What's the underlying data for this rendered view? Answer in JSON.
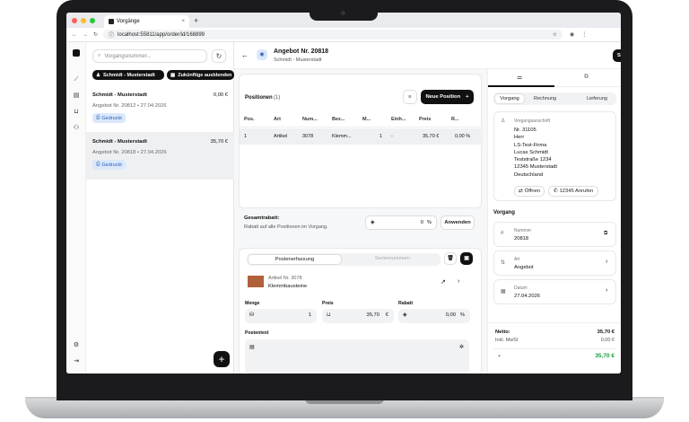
{
  "browser": {
    "tab_title": "Vorgänge",
    "url": "localhost:55811/app/order/id/168899"
  },
  "list": {
    "search_placeholder": "Vorgangsnummer...",
    "filter_customer": "Schmidt - Musterstadt",
    "filter_future": "Zukünftige ausblenden",
    "cards": [
      {
        "name": "Schmidt - Musterstadt",
        "amount": "0,00 €",
        "sub": "Angebot Nr. 20812 • 27.04.2026",
        "badge": "Gedruckt"
      },
      {
        "name": "Schmidt - Musterstadt",
        "amount": "35,70 €",
        "sub": "Angebot Nr. 20818 • 27.04.2026",
        "badge": "Gedruckt"
      }
    ]
  },
  "header": {
    "title": "Angebot Nr. 20818",
    "subtitle": "Schmidt - Musterstadt",
    "save": "Speichern"
  },
  "positions": {
    "title": "Positionen",
    "count": "(1)",
    "new_button": "Neue Position",
    "columns": [
      "Pos.",
      "Art",
      "Num...",
      "Bez...",
      "M...",
      "Einh...",
      "Preis",
      "R..."
    ],
    "rows": [
      [
        "1",
        "Artikel",
        "3078",
        "Klemm...",
        "1",
        "-",
        "35,70 €",
        "0,00 %"
      ]
    ]
  },
  "discount": {
    "title": "Gesamtrabatt:",
    "desc": "Rabatt auf alle Positionen im Vorgang.",
    "value": "0",
    "unit": "%",
    "apply": "Anwenden"
  },
  "editor": {
    "tab_active": "Postenerfassung",
    "tab_inactive": "Seriennummern",
    "article_no": "Artikel Nr. 3078",
    "article_name": "Klemmbausteine",
    "qty_label": "Menge",
    "qty": "1",
    "price_label": "Preis",
    "price": "35,70",
    "price_unit": "€",
    "discount_label": "Rabatt",
    "discount": "0,00",
    "discount_unit": "%",
    "text_label": "Postentext"
  },
  "side": {
    "tabs": [
      "Vorgang",
      "Rechnung",
      "Lieferung"
    ],
    "addr_label": "Vorgangsanschrift",
    "addr_lines": [
      "Nr. 31105",
      "Herr",
      "LS-Test-Firma",
      "Lucas Schmidt",
      "Teststraße 1234",
      "12345 Musterstadt",
      "Deutschland"
    ],
    "open": "Öffnen",
    "call": "12345 Anrufen",
    "section": "Vorgang",
    "fields": [
      {
        "label": "Nummer",
        "value": "20818"
      },
      {
        "label": "Art",
        "value": "Angebot"
      },
      {
        "label": "Datum",
        "value": "27.04.2026"
      }
    ],
    "net_label": "Netto:",
    "net": "35,70 €",
    "tax_label": "Inkl. MwSt",
    "tax": "0,00 €",
    "total": "35,70 €"
  }
}
